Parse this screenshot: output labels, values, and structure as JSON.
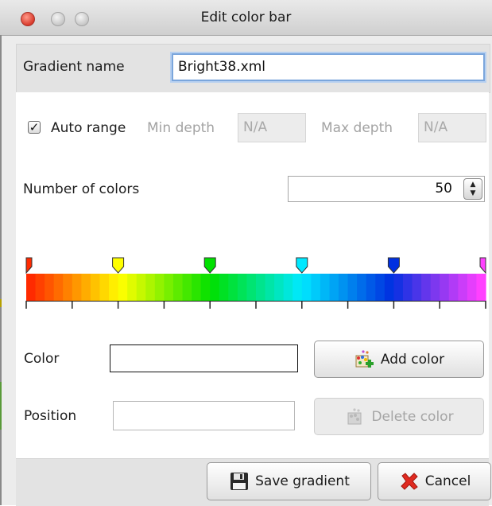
{
  "window": {
    "title": "Edit color bar"
  },
  "gradient_name": {
    "label": "Gradient name",
    "value": "Bright38.xml"
  },
  "auto_range": {
    "label": "Auto range",
    "checked": true
  },
  "min_depth": {
    "label": "Min depth",
    "value": "N/A"
  },
  "max_depth": {
    "label": "Max depth",
    "value": "N/A"
  },
  "num_colors": {
    "label": "Number of colors",
    "value": "50"
  },
  "color_bar": {
    "segments": 50,
    "stops": [
      {
        "position": 0.0,
        "color": "#ff2a00"
      },
      {
        "position": 0.2,
        "color": "#ffff00"
      },
      {
        "position": 0.4,
        "color": "#00e000"
      },
      {
        "position": 0.6,
        "color": "#00e8ff"
      },
      {
        "position": 0.8,
        "color": "#0030e0"
      },
      {
        "position": 1.0,
        "color": "#ff40ff"
      }
    ],
    "tick_count": 11
  },
  "color_field": {
    "label": "Color",
    "value": ""
  },
  "position_field": {
    "label": "Position",
    "value": ""
  },
  "buttons": {
    "add_color": "Add color",
    "delete_color": "Delete color",
    "save_gradient": "Save gradient",
    "cancel": "Cancel"
  },
  "icons": {
    "add_color": "palette-plus-icon",
    "delete_color": "palette-icon",
    "save_gradient": "floppy-disk-icon",
    "cancel": "red-x-icon"
  }
}
